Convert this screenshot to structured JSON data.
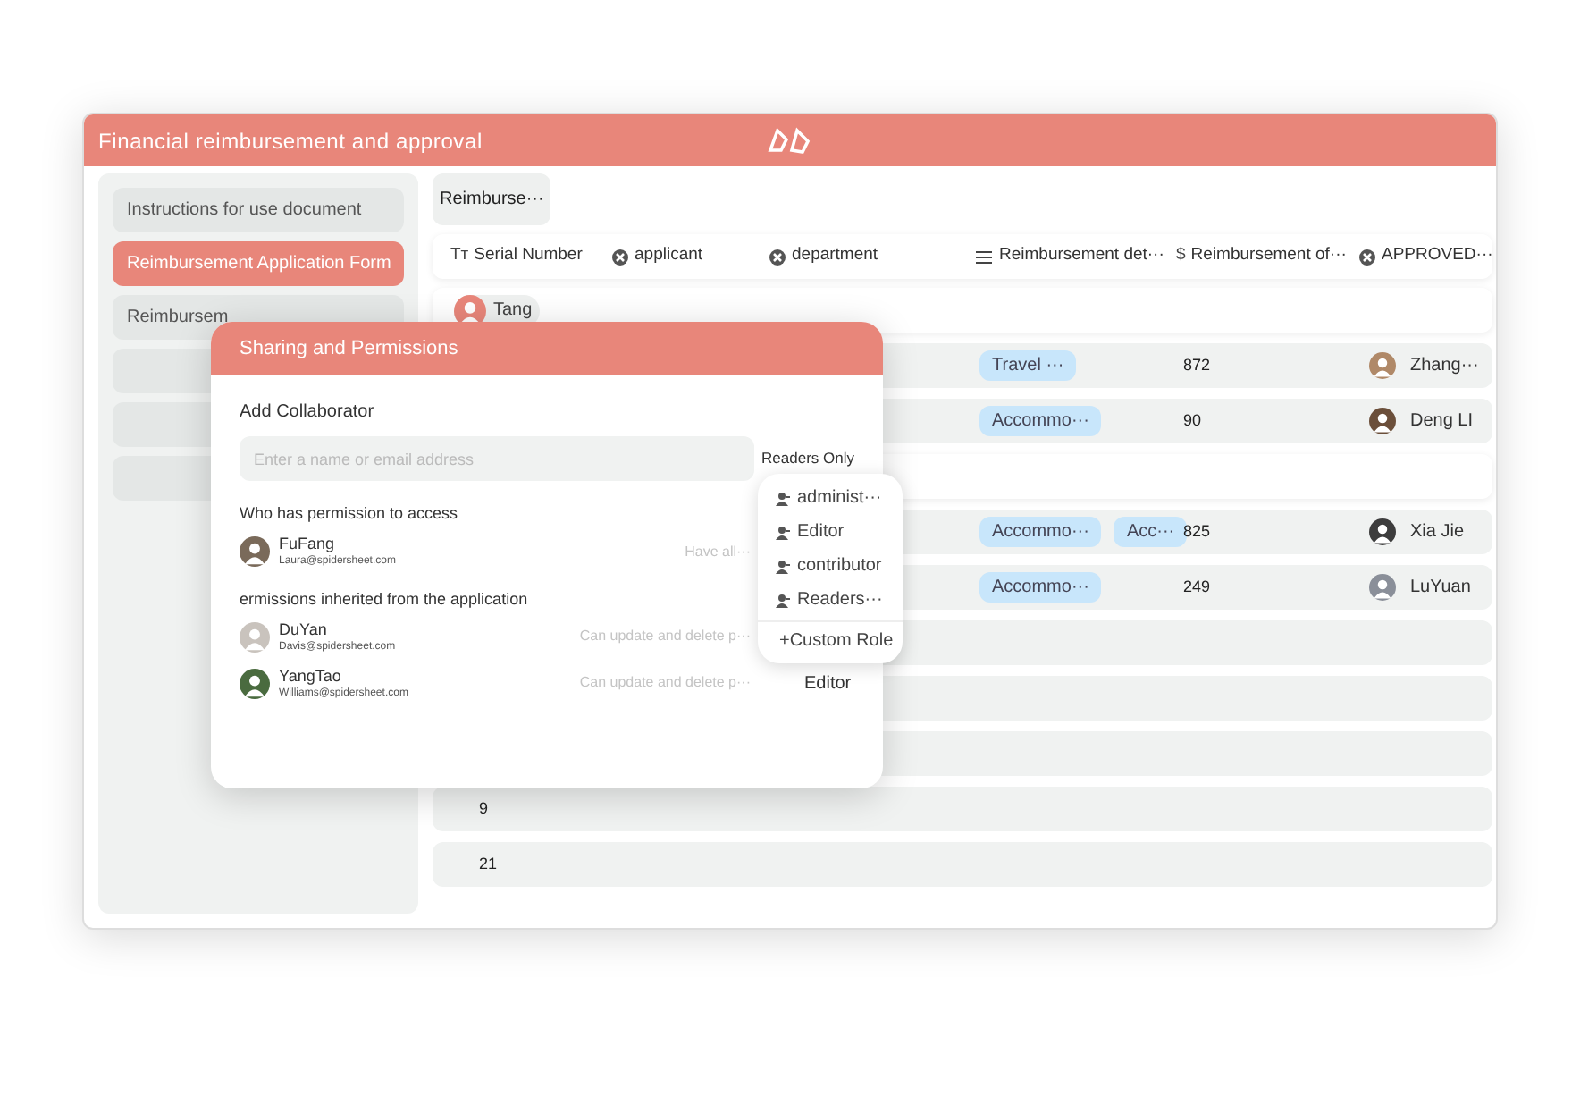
{
  "window": {
    "title": "Financial reimbursement and approval"
  },
  "sidebar": {
    "items": [
      {
        "label": "Instructions for use document",
        "selected": false
      },
      {
        "label": "Reimbursement Application Form",
        "selected": true
      },
      {
        "label": "Reimbursem",
        "selected": false
      },
      {
        "selected": false
      },
      {
        "selected": false
      },
      {
        "selected": false
      }
    ]
  },
  "view_tabs": [
    {
      "label": "Reimburse···",
      "selected": true
    }
  ],
  "table": {
    "columns": [
      {
        "label": "Serial Number",
        "icon": "Tт"
      },
      {
        "label": "applicant",
        "kind": "member"
      },
      {
        "label": "department",
        "kind": "member"
      },
      {
        "label": "Reimbursement det···",
        "kind": "list"
      },
      {
        "label": "Reimbursement of···",
        "icon": "$"
      },
      {
        "label": "APPROVED···",
        "kind": "member"
      }
    ],
    "rows": [
      {
        "kind": "group",
        "label": "Tang"
      },
      {
        "kind": "record",
        "tags": [
          "Travel ···"
        ],
        "amount": "872",
        "approver": "Zhang···"
      },
      {
        "kind": "record",
        "tags": [
          "Accommo···"
        ],
        "amount": "90",
        "approver": "Deng LI"
      },
      {
        "kind": "group"
      },
      {
        "kind": "record",
        "tags": [
          "Accommo···",
          "Acc···"
        ],
        "amount": "825",
        "approver": "Xia Jie"
      },
      {
        "kind": "record",
        "tags": [
          "Accommo···"
        ],
        "amount": "249",
        "approver": "LuYuan"
      },
      {
        "kind": "record"
      },
      {
        "kind": "record"
      },
      {
        "kind": "record"
      },
      {
        "kind": "record",
        "serial": "9"
      },
      {
        "kind": "record",
        "serial": "21"
      }
    ]
  },
  "dialog": {
    "title": "Sharing and Permissions",
    "add_label": "Add Collaborator",
    "search": {
      "placeholder": "Enter a name or email address"
    },
    "role": "Readers Only",
    "sections": [
      {
        "title": "Who has permission to access",
        "members": [
          {
            "name": "FuFang",
            "email": "Laura@spidersheet.com",
            "permission": "Have all···"
          }
        ]
      },
      {
        "title": "ermissions inherited from the application",
        "members": [
          {
            "name": "DuYan",
            "email": "Davis@spidersheet.com",
            "permission": "Can update and delete p···"
          },
          {
            "name": "YangTao",
            "email": "Williams@spidersheet.com",
            "permission": "Can update and delete p···",
            "role": "Editor"
          }
        ]
      }
    ]
  },
  "role_menu": {
    "items": [
      "administ···",
      "Editor",
      "contributor",
      "Readers···"
    ],
    "footer": "+Custom Role"
  }
}
